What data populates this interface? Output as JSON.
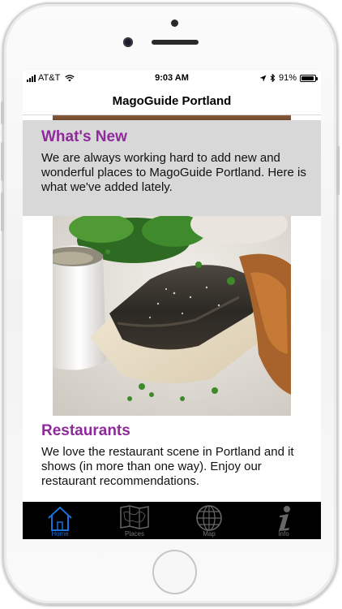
{
  "status_bar": {
    "carrier": "AT&T",
    "time": "9:03 AM",
    "battery_percent": "91%",
    "battery_level": 0.91
  },
  "nav": {
    "title": "MagoGuide Portland"
  },
  "sections": {
    "whats_new": {
      "title": "What's New",
      "body": "We are always working hard to add new and wonderful places to MagoGuide Portland. Here is what we've added lately."
    },
    "restaurants": {
      "title": "Restaurants",
      "body": "We love the restaurant scene in Portland and it shows (in more than one way). Enjoy our restaurant recommendations."
    }
  },
  "tabs": [
    {
      "label": "Home",
      "icon": "home-icon",
      "active": true
    },
    {
      "label": "Places",
      "icon": "map-pages-icon",
      "active": false
    },
    {
      "label": "Map",
      "icon": "globe-icon",
      "active": false
    },
    {
      "label": "Info",
      "icon": "info-icon",
      "active": false
    }
  ],
  "colors": {
    "section_title": "#8e2a9a",
    "whats_new_background": "#d8d8d8",
    "tab_bar_background": "#000000",
    "tab_active": "#1a6fd8",
    "tab_inactive": "#777777"
  }
}
